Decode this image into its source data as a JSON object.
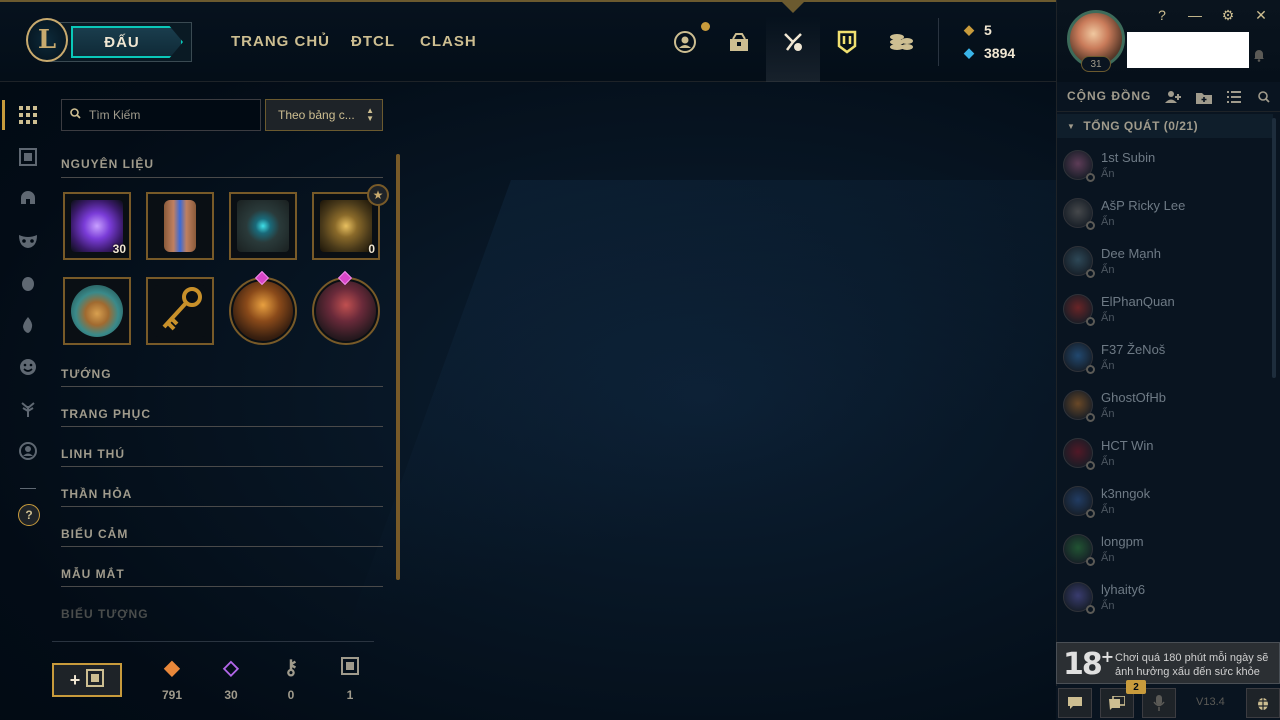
{
  "header": {
    "logo_letter": "L",
    "play_label": "ĐẤU",
    "nav": [
      "TRANG CHỦ",
      "ĐTCL",
      "CLASH"
    ],
    "icons": [
      "profile-icon",
      "collection-chest-icon",
      "loot-hammer-icon",
      "tft-pass-icon",
      "store-coins-icon"
    ],
    "currency": {
      "rp_icon": "rp-icon",
      "rp": "5",
      "be_icon": "blue-essence-icon",
      "be": "3894"
    },
    "profile": {
      "level": "31",
      "name_hidden": true
    },
    "window_controls": [
      "?",
      "—",
      "⚙",
      "✕"
    ]
  },
  "sidebar": {
    "icons": [
      "grid-icon",
      "chest-icon",
      "helmet-icon",
      "mask-icon",
      "egg-icon",
      "flame-icon",
      "emote-icon",
      "tree-icon",
      "profile-circle-icon"
    ],
    "help_label": "?"
  },
  "loot": {
    "search_placeholder": "Tìm Kiếm",
    "sort_label": "Theo bảng c...",
    "sections": [
      "NGUYÊN LIỆU",
      "TƯỚNG",
      "TRANG PHỤC",
      "LINH THÚ",
      "THẦN HỎA",
      "BIỂU CẢM",
      "MẪU MẮT",
      "BIỂU TƯỢNG"
    ],
    "items": [
      {
        "name": "gemstone",
        "count": "30"
      },
      {
        "name": "capsule",
        "count": ""
      },
      {
        "name": "hextech-chest",
        "count": ""
      },
      {
        "name": "masterwork-chest",
        "count": "0"
      },
      {
        "name": "egg",
        "count": ""
      },
      {
        "name": "key",
        "count": ""
      },
      {
        "name": "skin-shard-1",
        "count": ""
      },
      {
        "name": "skin-shard-2",
        "count": ""
      }
    ],
    "mastery_badge": "★",
    "resources": [
      {
        "icon": "orange-essence-icon",
        "value": "791"
      },
      {
        "icon": "mythic-essence-icon",
        "value": "30"
      },
      {
        "icon": "key-fragment-icon",
        "value": "0"
      },
      {
        "icon": "chest-icon",
        "value": "1"
      }
    ],
    "craft_plus": "+"
  },
  "social": {
    "title": "CỘNG ĐỒNG",
    "group": "TỔNG QUÁT (0/21)",
    "friends": [
      {
        "name": "1st Subin",
        "status": "Ẩn"
      },
      {
        "name": "AšP Ricky Lee",
        "status": "Ẩn"
      },
      {
        "name": "Dee Mạnh",
        "status": "Ẩn"
      },
      {
        "name": "ElPhanQuan",
        "status": "Ẩn"
      },
      {
        "name": "F37 ŽeNoš",
        "status": "Ẩn"
      },
      {
        "name": "GhostOfHb",
        "status": "Ẩn"
      },
      {
        "name": "HCT Win",
        "status": "Ẩn"
      },
      {
        "name": "k3nngok",
        "status": "Ẩn"
      },
      {
        "name": "longpm",
        "status": "Ẩn"
      },
      {
        "name": "lyhaity6",
        "status": "Ẩn"
      }
    ],
    "warning_age": "18",
    "warning_plus": "+",
    "warning_text": "Chơi quá 180 phút mỗi ngày sẽ ảnh hưởng xấu đến sức khỏe",
    "notif_count": "2",
    "version": "V13.4"
  },
  "colors": {
    "gold": "#c89b3c",
    "teal": "#0ac8b9",
    "text": "#a09b8c",
    "bg": "#010a13"
  }
}
